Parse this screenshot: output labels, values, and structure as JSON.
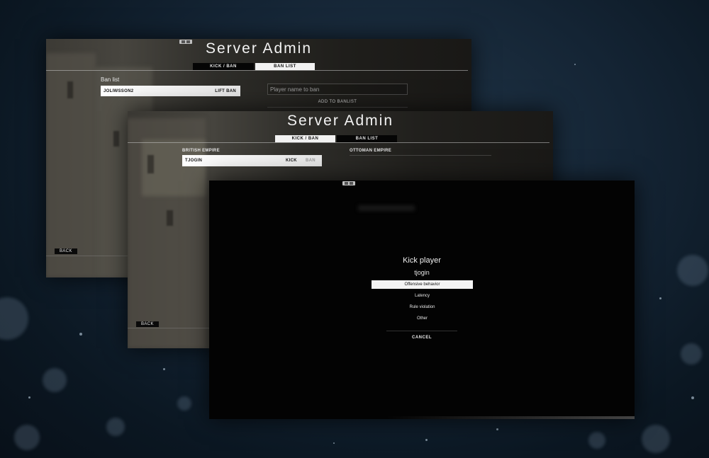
{
  "screen_a": {
    "title": "Server Admin",
    "tabs": [
      {
        "label": "KICK / BAN",
        "active": false
      },
      {
        "label": "BAN LIST",
        "active": true
      }
    ],
    "section_label": "Ban list",
    "banned_players": [
      {
        "name": "JOLIWSSON2",
        "action": "LIFT BAN"
      }
    ],
    "ban_input": {
      "placeholder": "Player name to ban"
    },
    "add_button": "ADD TO BANLIST",
    "back_label": "BACK"
  },
  "screen_b": {
    "title": "Server Admin",
    "tabs": [
      {
        "label": "KICK / BAN",
        "active": true
      },
      {
        "label": "BAN LIST",
        "active": false
      }
    ],
    "team_left": "BRITISH EMPIRE",
    "team_right": "OTTOMAN EMPIRE",
    "players": [
      {
        "name": "TJOGIN",
        "kick_label": "KICK",
        "ban_label": "BAN"
      }
    ],
    "back_label": "BACK"
  },
  "kick_dialog": {
    "title": "Kick player",
    "player_name": "tjogin",
    "reasons": [
      {
        "label": "Offensive behavior",
        "selected": true
      },
      {
        "label": "Latency",
        "selected": false
      },
      {
        "label": "Rule violation",
        "selected": false
      },
      {
        "label": "Other",
        "selected": false
      }
    ],
    "cancel_label": "CANCEL"
  },
  "icons": [
    "window-controls-icon"
  ],
  "colors": {
    "background": "#0b1722",
    "panel_dark": "#030303",
    "highlight": "#f2f2f2"
  }
}
